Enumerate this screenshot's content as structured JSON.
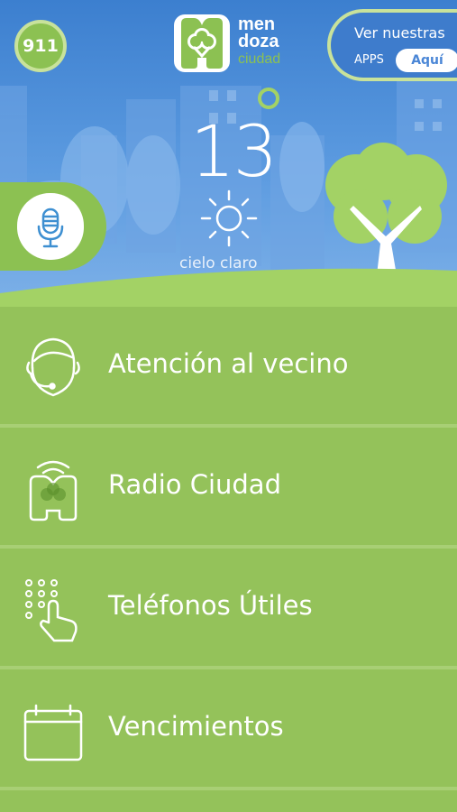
{
  "header": {
    "emergency_label": "911",
    "logo_lines": [
      "men",
      "doza",
      "ciudad"
    ],
    "apps_line1": "Ver nuestras",
    "apps_line2": "APPS",
    "apps_button": "Aquí"
  },
  "weather": {
    "temperature": "13",
    "description": "cielo claro",
    "icon": "sun-icon"
  },
  "menu": {
    "items": [
      {
        "label": "Atención al vecino",
        "icon": "headset-agent-icon"
      },
      {
        "label": "Radio Ciudad",
        "icon": "radio-ciudad-icon"
      },
      {
        "label": "Teléfonos Útiles",
        "icon": "dialpad-touch-icon"
      },
      {
        "label": "Vencimientos",
        "icon": "calendar-icon"
      }
    ]
  },
  "colors": {
    "green": "#94c25a",
    "light_green": "#c8e29b",
    "sky_blue": "#3c7fcf",
    "white": "#ffffff"
  }
}
